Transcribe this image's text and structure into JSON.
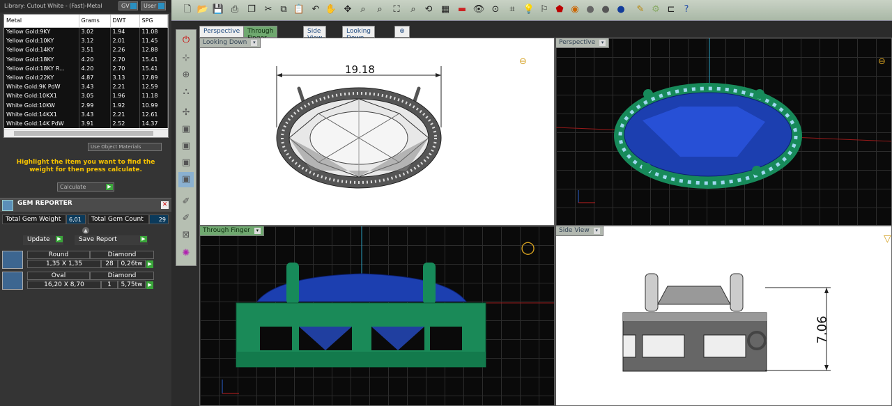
{
  "library": {
    "title": "Library: Cutout White - (Fast)-Metal",
    "gv_btn": "GV",
    "user_btn": "User"
  },
  "metal_table": {
    "headers": [
      "Metal",
      "Grams",
      "DWT",
      "SPG"
    ],
    "rows": [
      [
        "Yellow Gold:9KY",
        "3.02",
        "1.94",
        "11.08"
      ],
      [
        "Yellow Gold:10KY",
        "3.12",
        "2.01",
        "11.45"
      ],
      [
        "Yellow Gold:14KY",
        "3.51",
        "2.26",
        "12.88"
      ],
      [
        "Yellow Gold:18KY",
        "4.20",
        "2.70",
        "15.41"
      ],
      [
        "Yellow Gold:18KY R...",
        "4.20",
        "2.70",
        "15.41"
      ],
      [
        "Yellow Gold:22KY",
        "4.87",
        "3.13",
        "17.89"
      ],
      [
        "White Gold:9K PdW",
        "3.43",
        "2.21",
        "12.59"
      ],
      [
        "White Gold:10KX1",
        "3.05",
        "1.96",
        "11.18"
      ],
      [
        "White Gold:10KW",
        "2.99",
        "1.92",
        "10.99"
      ],
      [
        "White Gold:14KX1",
        "3.43",
        "2.21",
        "12.61"
      ],
      [
        "White Gold:14K PdW",
        "3.91",
        "2.52",
        "14.37"
      ]
    ]
  },
  "use_object_materials": "Use Object Materials",
  "highlight_text": "Highlight the item you want to find the weight for then press calculate.",
  "calculate_label": "Calculate",
  "gem_reporter": {
    "title": "GEM REPORTER",
    "total_weight_label": "Total Gem Weight",
    "total_weight_value": "6,01",
    "total_count_label": "Total Gem Count",
    "total_count_value": "29",
    "update_label": "Update",
    "save_label": "Save Report",
    "gems": [
      {
        "shape": "Round",
        "material": "Diamond",
        "size": "1,35 X 1,35",
        "count": "28",
        "weight": "0,26tw"
      },
      {
        "shape": "Oval",
        "material": "Diamond",
        "size": "16,20 X 8,70",
        "count": "1",
        "weight": "5,75tw"
      }
    ]
  },
  "tabs": [
    "Perspective",
    "Through Finger",
    "Side View",
    "Looking Down"
  ],
  "viewports": {
    "top_left": "Looking Down",
    "top_right": "Perspective",
    "bottom_left": "Through Finger",
    "bottom_right": "Side View"
  },
  "dimensions": {
    "width": "19.18",
    "height": "7.06"
  },
  "colors": {
    "accent_green": "#6fa86f",
    "gem_blue": "#1b3fb8",
    "metal_green": "#1f8a5a",
    "highlight_yellow": "#f6c200"
  }
}
